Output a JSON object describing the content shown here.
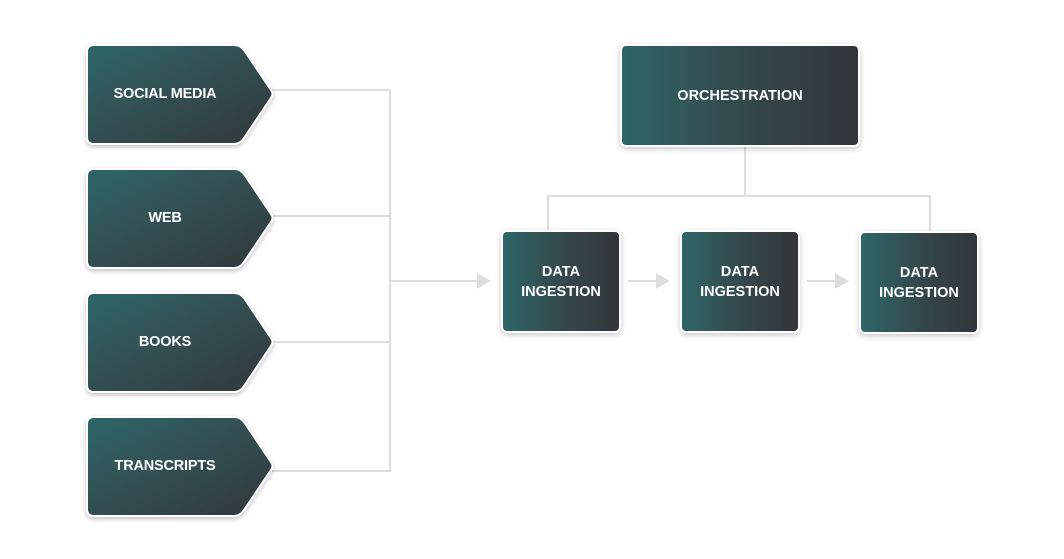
{
  "diagram": {
    "sources": [
      {
        "label": "SOCIAL MEDIA"
      },
      {
        "label": "WEB"
      },
      {
        "label": "BOOKS"
      },
      {
        "label": "TRANSCRIPTS"
      }
    ],
    "orchestration": {
      "label": "ORCHESTRATION"
    },
    "pipeline": [
      {
        "line1": "DATA",
        "line2": "INGESTION"
      },
      {
        "line1": "DATA",
        "line2": "INGESTION"
      },
      {
        "line1": "DATA",
        "line2": "INGESTION"
      }
    ],
    "colors": {
      "gradient_start": "#2f6668",
      "gradient_end": "#32363b",
      "connector": "#dddddd",
      "text": "#ffffff"
    }
  }
}
